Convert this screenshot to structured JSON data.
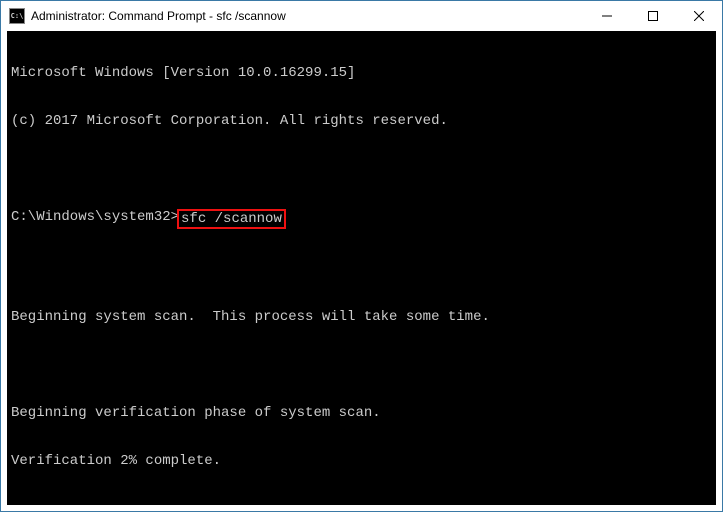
{
  "window": {
    "title": "Administrator: Command Prompt - sfc  /scannow",
    "icon_label": "C:\\"
  },
  "console": {
    "line1": "Microsoft Windows [Version 10.0.16299.15]",
    "line2": "(c) 2017 Microsoft Corporation. All rights reserved.",
    "prompt": "C:\\Windows\\system32>",
    "command": "sfc /scannow",
    "line3": "Beginning system scan.  This process will take some time.",
    "line4": "Beginning verification phase of system scan.",
    "line5": "Verification 2% complete."
  }
}
